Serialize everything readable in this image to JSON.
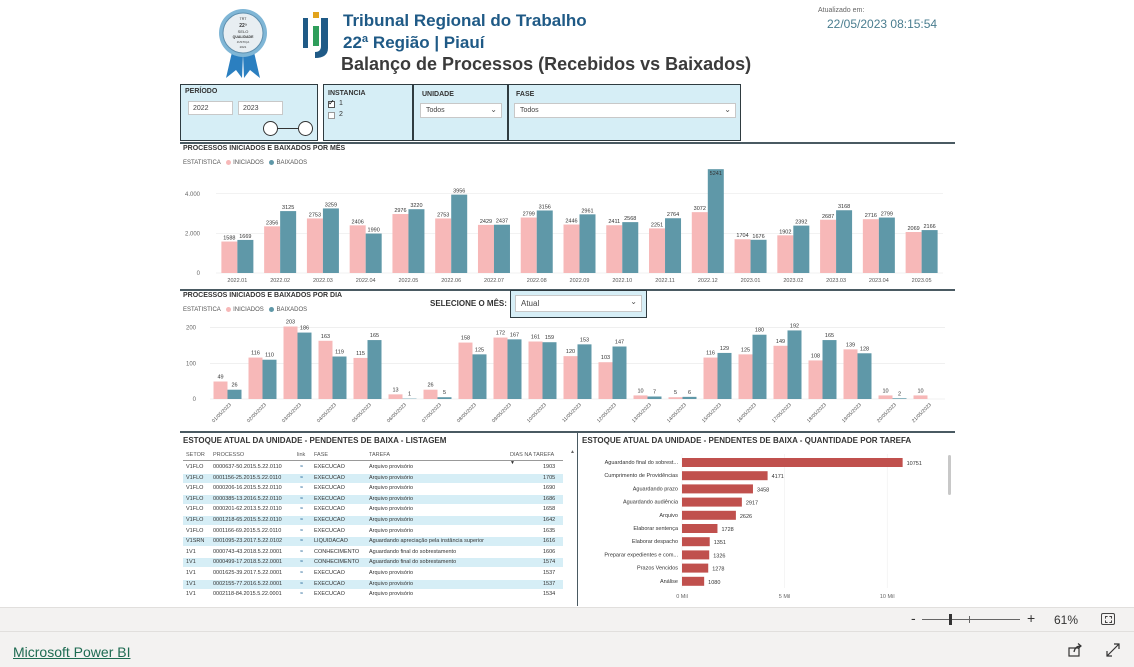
{
  "header": {
    "org_name": "Tribunal Regional do Trabalho",
    "org_region": "22ª Região | Piauí",
    "report_title": "Balanço de Processos (Recebidos vs Baixados)",
    "updated_label": "Atualizado em:",
    "updated_value": "22/05/2023 08:15:54",
    "seal_text": [
      "TRT",
      "22ª",
      "SELO",
      "QUALIDADE",
      "JUSTIÇA",
      "2021"
    ]
  },
  "filters": {
    "periodo": {
      "label": "PERÍODO",
      "from": "2022",
      "to": "2023"
    },
    "instancia": {
      "label": "INSTANCIA",
      "options": [
        {
          "label": "1",
          "checked": true
        },
        {
          "label": "2",
          "checked": false
        }
      ]
    },
    "unidade": {
      "label": "UNIDADE",
      "value": "Todos"
    },
    "fase": {
      "label": "FASE",
      "value": "Todos"
    }
  },
  "colors": {
    "iniciados": "#f7b8b8",
    "baixados": "#5f98a8",
    "hbar": "#c0504d",
    "accent": "#d6eef6"
  },
  "monthly": {
    "title": "PROCESSOS INICIADOS E BAIXADOS POR MÊS",
    "legend_label": "ESTATISTICA",
    "series_names": [
      "INICIADOS",
      "BAIXADOS"
    ],
    "chart_data": {
      "type": "bar",
      "categories": [
        "2022.01",
        "2022.02",
        "2022.03",
        "2022.04",
        "2022.05",
        "2022.06",
        "2022.07",
        "2022.08",
        "2022.09",
        "2022.10",
        "2022.11",
        "2022.12",
        "2023.01",
        "2023.02",
        "2023.03",
        "2023.04",
        "2023.05"
      ],
      "series": [
        {
          "name": "INICIADOS",
          "values": [
            1588,
            2356,
            2753,
            2406,
            2976,
            2753,
            2429,
            2799,
            2446,
            2411,
            2251,
            3072,
            1704,
            1902,
            2687,
            2716,
            2069
          ]
        },
        {
          "name": "BAIXADOS",
          "values": [
            1669,
            3125,
            3259,
            1990,
            3220,
            3956,
            2437,
            3156,
            2961,
            2568,
            2764,
            5241,
            1676,
            2392,
            3168,
            2799,
            2166
          ]
        }
      ],
      "baixados_labels": [
        "1669",
        "3125",
        "3259",
        "1990",
        "3220",
        "3956",
        "2437",
        "3156",
        "2961",
        "2568",
        "2764",
        "",
        "1676",
        "2392",
        "3168",
        "2799",
        "2166"
      ],
      "y_ticks": [
        "0",
        "2.000",
        "4.000"
      ],
      "ylim": [
        0,
        5300
      ]
    }
  },
  "daily": {
    "title": "PROCESSOS INICIADOS E BAIXADOS POR DIA",
    "legend_label": "ESTATISTICA",
    "series_names": [
      "INICIADOS",
      "BAIXADOS"
    ],
    "month_selector": {
      "label": "SELECIONE O MÊS:",
      "value": "Atual"
    },
    "chart_data": {
      "type": "bar",
      "categories": [
        "01/05/2023",
        "02/05/2023",
        "03/05/2023",
        "04/05/2023",
        "05/05/2023",
        "06/05/2023",
        "07/05/2023",
        "08/05/2023",
        "09/05/2023",
        "10/05/2023",
        "11/05/2023",
        "12/05/2023",
        "13/05/2023",
        "14/05/2023",
        "15/05/2023",
        "16/05/2023",
        "17/05/2023",
        "18/05/2023",
        "19/05/2023",
        "20/05/2023",
        "21/05/2023"
      ],
      "series": [
        {
          "name": "INICIADOS",
          "values": [
            49,
            116,
            203,
            163,
            115,
            13,
            26,
            158,
            172,
            161,
            120,
            103,
            10,
            5,
            116,
            125,
            149,
            108,
            139,
            10,
            10
          ]
        },
        {
          "name": "BAIXADOS",
          "values": [
            26,
            110,
            186,
            119,
            165,
            1,
            5,
            125,
            167,
            159,
            153,
            147,
            7,
            6,
            129,
            180,
            192,
            165,
            128,
            2,
            0
          ]
        }
      ],
      "iniciados_labels": [
        "49",
        "116",
        "203",
        "163",
        "115",
        "13",
        "26",
        "158",
        "172",
        "161",
        "120",
        "103",
        "10",
        "5",
        "116",
        "125",
        "149",
        "108",
        "139",
        "10",
        "10"
      ],
      "baixados_labels": [
        "26",
        "110",
        "186",
        "119",
        "165",
        "1",
        "5",
        "125",
        "167",
        "159",
        "153",
        "147",
        "7",
        "6",
        "129",
        "180",
        "192",
        "165",
        "128",
        "2",
        ""
      ],
      "y_ticks": [
        "0",
        "100",
        "200"
      ],
      "ylim": [
        0,
        210
      ]
    }
  },
  "pending_table": {
    "title": "ESTOQUE ATUAL DA UNIDADE - PENDENTES DE BAIXA - LISTAGEM",
    "columns": [
      "SETOR",
      "PROCESSO",
      "link",
      "FASE",
      "TAREFA",
      "DIAS NA TAREFA"
    ],
    "rows": [
      [
        "V1FLO",
        "0000637-50.2015.5.22.0110",
        "EXECUCAO",
        "Arquivo provisório",
        "1903"
      ],
      [
        "V1FLO",
        "0001156-25.2015.5.22.0110",
        "EXECUCAO",
        "Arquivo provisório",
        "1705"
      ],
      [
        "V1FLO",
        "0000206-16.2015.5.22.0110",
        "EXECUCAO",
        "Arquivo provisório",
        "1690"
      ],
      [
        "V1FLO",
        "0000385-13.2016.5.22.0110",
        "EXECUCAO",
        "Arquivo provisório",
        "1686"
      ],
      [
        "V1FLO",
        "0000201-62.2013.5.22.0110",
        "EXECUCAO",
        "Arquivo provisório",
        "1658"
      ],
      [
        "V1FLO",
        "0001218-65.2015.5.22.0110",
        "EXECUCAO",
        "Arquivo provisório",
        "1642"
      ],
      [
        "V1FLO",
        "0001166-69.2015.5.22.0110",
        "EXECUCAO",
        "Arquivo provisório",
        "1635"
      ],
      [
        "V1SRN",
        "0001095-23.2017.5.22.0102",
        "LIQUIDACAO",
        "Aguardando apreciação pela instância superior",
        "1616"
      ],
      [
        "1V1",
        "0000743-43.2018.5.22.0001",
        "CONHECIMENTO",
        "Aguardando final do sobrestamento",
        "1606"
      ],
      [
        "1V1",
        "0000499-17.2018.5.22.0001",
        "CONHECIMENTO",
        "Aguardando final do sobrestamento",
        "1574"
      ],
      [
        "1V1",
        "0001625-39.2017.5.22.0001",
        "EXECUCAO",
        "Arquivo provisório",
        "1537"
      ],
      [
        "1V1",
        "0002155-77.2016.5.22.0001",
        "EXECUCAO",
        "Arquivo provisório",
        "1537"
      ],
      [
        "1V1",
        "0002118-84.2015.5.22.0001",
        "EXECUCAO",
        "Arquivo provisório",
        "1534"
      ]
    ]
  },
  "task_chart": {
    "title": "ESTOQUE ATUAL DA UNIDADE - PENDENTES DE BAIXA - QUANTIDADE POR TAREFA",
    "chart_data": {
      "type": "bar",
      "orientation": "horizontal",
      "categories": [
        "Aguardando final do sobrest...",
        "Cumprimento de Providências",
        "Aguardando prazo",
        "Aguardando audiência",
        "Arquivo",
        "Elaborar sentença",
        "Elaborar despacho",
        "Preparar expedientes e com...",
        "Prazos Vencidos",
        "Análise"
      ],
      "values": [
        10751,
        4171,
        3458,
        2917,
        2626,
        1728,
        1351,
        1326,
        1278,
        1080
      ],
      "x_ticks": [
        "0 Mil",
        "5 Mil",
        "10 Mil"
      ],
      "xlim": [
        0,
        11500
      ]
    }
  },
  "zoom": {
    "minus": "-",
    "plus": "+",
    "value": "61%"
  },
  "footer": {
    "brand": "Microsoft Power BI"
  }
}
